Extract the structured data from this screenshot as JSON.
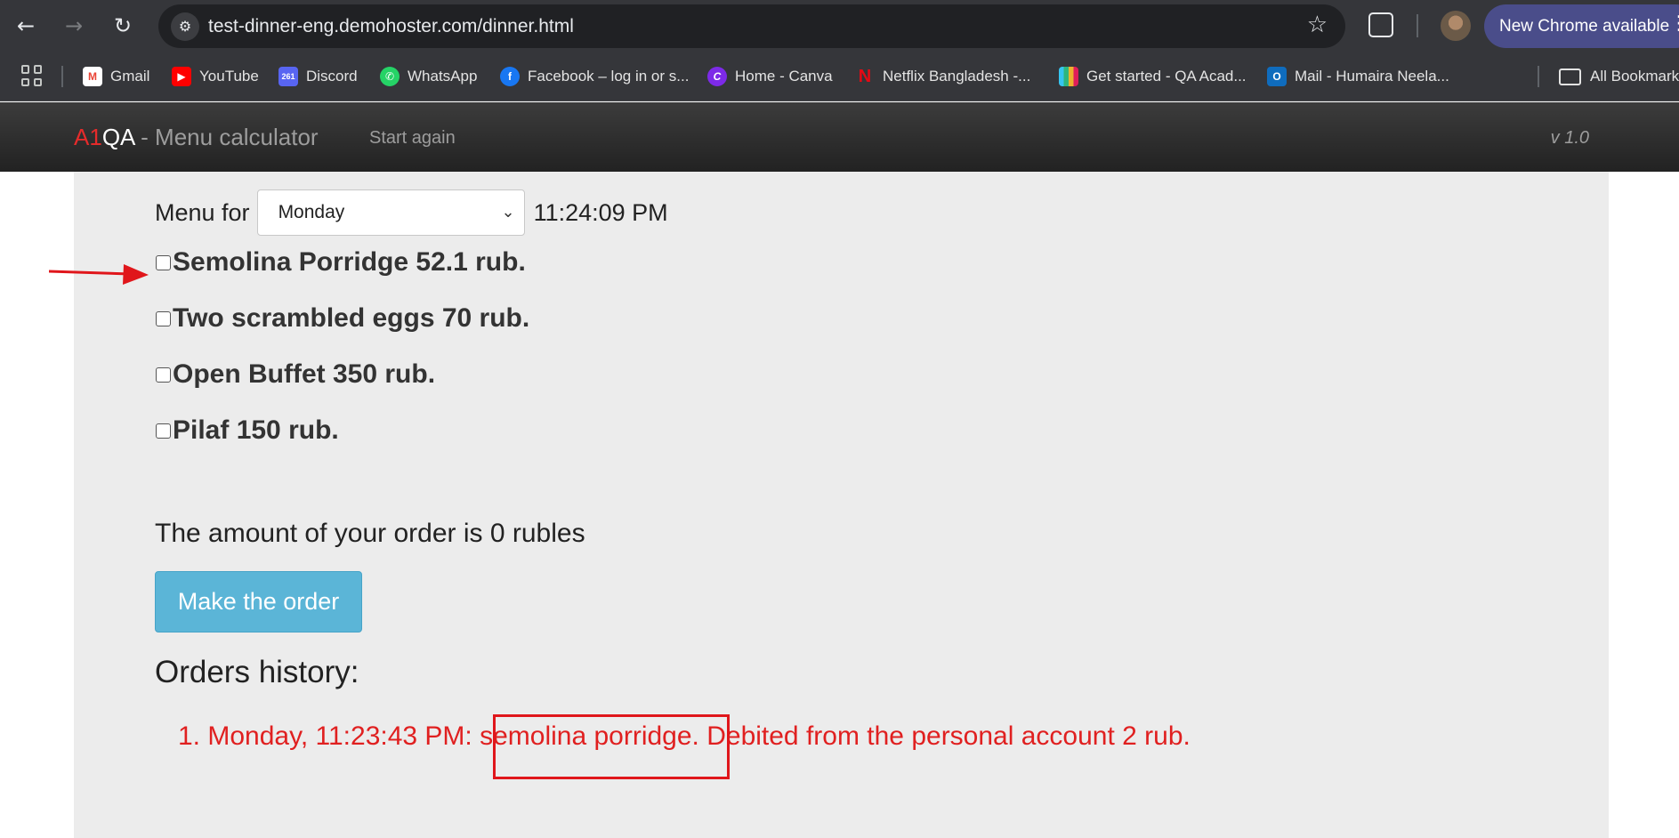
{
  "browser": {
    "url": "test-dinner-eng.demohoster.com/dinner.html",
    "update_label": "New Chrome available",
    "bookmarks": [
      {
        "label": "Gmail",
        "icon": "gmail-icon"
      },
      {
        "label": "YouTube",
        "icon": "youtube-icon"
      },
      {
        "label": "Discord",
        "icon": "discord-icon"
      },
      {
        "label": "WhatsApp",
        "icon": "whatsapp-icon"
      },
      {
        "label": "Facebook – log in or s...",
        "icon": "facebook-icon"
      },
      {
        "label": "Home - Canva",
        "icon": "canva-icon"
      },
      {
        "label": "Netflix Bangladesh -...",
        "icon": "netflix-icon"
      },
      {
        "label": "Get started - QA Acad...",
        "icon": "slack-icon"
      },
      {
        "label": "Mail - Humaira Neela...",
        "icon": "outlook-icon"
      }
    ],
    "all_bookmarks_label": "All Bookmarks",
    "discord_badge": "261"
  },
  "app": {
    "brand_a1": "A1",
    "brand_qa": "QA",
    "brand_rest": " - Menu calculator",
    "start_again": "Start again",
    "version": "v 1.0"
  },
  "menu": {
    "menu_for_label": "Menu for",
    "selected_day": "Monday",
    "current_time": "11:24:09 PM",
    "dishes": [
      {
        "label": "Semolina Porridge 52.1 rub.",
        "checked": false
      },
      {
        "label": "Two scrambled eggs 70 rub.",
        "checked": false
      },
      {
        "label": "Open Buffet 350 rub.",
        "checked": false
      },
      {
        "label": "Pilaf 150 rub.",
        "checked": false
      }
    ],
    "amount_text": "The amount of your order is 0 rubles",
    "order_button": "Make the order"
  },
  "history": {
    "title": "Orders history:",
    "items": [
      "1. Monday, 11:23:43 PM: semolina porridge. Debited from the personal account 2 rub."
    ]
  },
  "colors": {
    "brand_red": "#e52b2b",
    "history_red": "#e02020",
    "order_button": "#5bb5d7",
    "annotation_red": "#e0161b"
  }
}
